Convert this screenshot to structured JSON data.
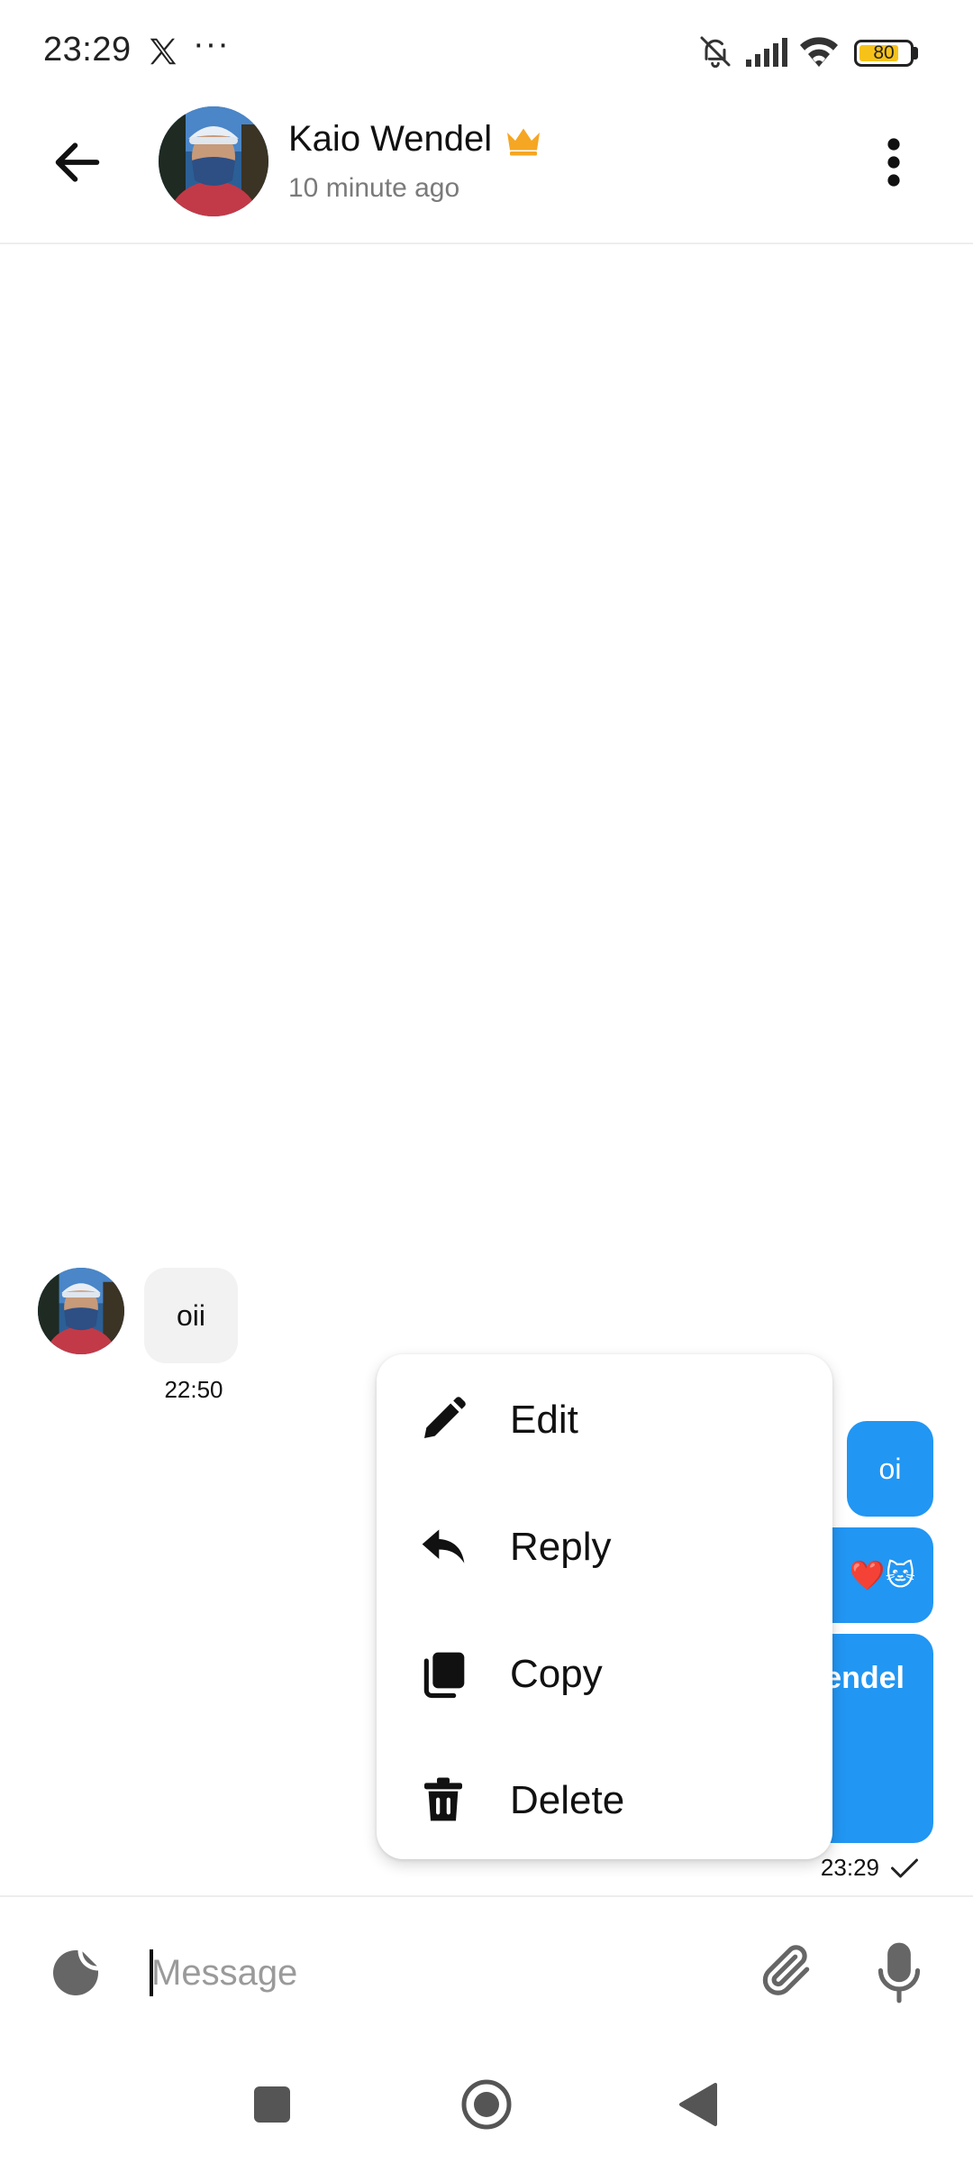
{
  "status_bar": {
    "time": "23:29",
    "more": "···",
    "battery_level": 80,
    "battery_label": "80",
    "battery_color": "#f6c21a"
  },
  "header": {
    "back_icon": "arrow-left-icon",
    "contact_name": "Kaio Wendel",
    "badge_icon": "crown-icon",
    "badge_color": "#f5a623",
    "last_seen": "10 minute ago",
    "menu_icon": "more-vertical-icon"
  },
  "messages": {
    "incoming": [
      {
        "text": "oii",
        "time": "22:50"
      }
    ],
    "outgoing": [
      {
        "text": "oi"
      },
      {
        "text": "❤️🐱"
      },
      {
        "text": "endel"
      }
    ],
    "outgoing_time": "23:29",
    "outgoing_status_icon": "check-icon",
    "outgoing_color": "#2196f3"
  },
  "context_menu": {
    "items": [
      {
        "label": "Edit",
        "icon": "pencil-icon"
      },
      {
        "label": "Reply",
        "icon": "reply-icon"
      },
      {
        "label": "Copy",
        "icon": "copy-icon"
      },
      {
        "label": "Delete",
        "icon": "trash-icon"
      }
    ]
  },
  "composer": {
    "placeholder": "Message",
    "value": "",
    "left_icon": "sticker-icon",
    "attach_icon": "paperclip-icon",
    "mic_icon": "microphone-icon"
  },
  "nav_bar": {
    "icons": [
      "recents-icon",
      "home-icon",
      "back-triangle-icon"
    ]
  }
}
